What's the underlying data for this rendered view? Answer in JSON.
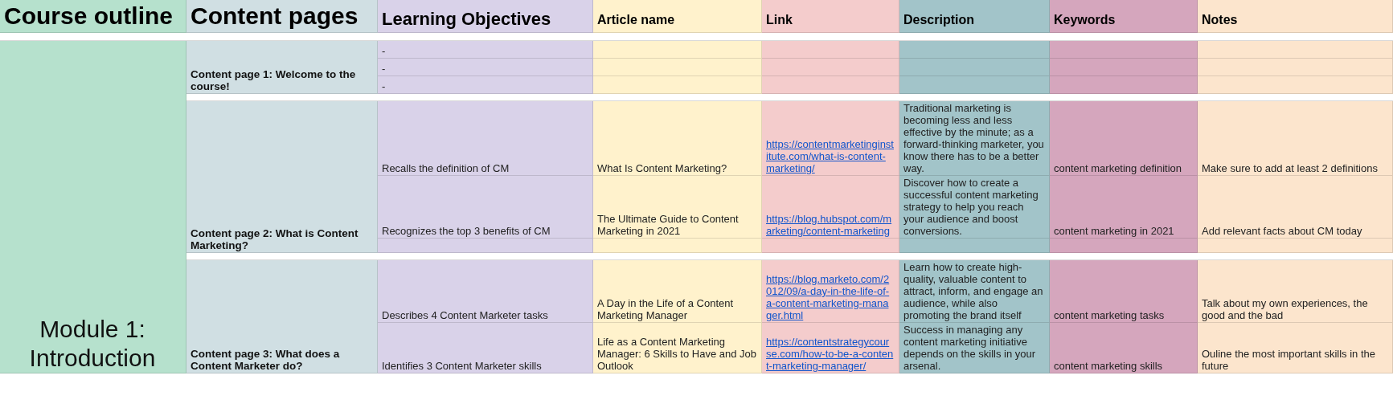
{
  "columns": [
    {
      "label": "Course outline",
      "kind": "large",
      "color": "#b6e1cd"
    },
    {
      "label": "Content pages",
      "kind": "large",
      "color": "#d0dfe3"
    },
    {
      "label": "Learning Objectives",
      "kind": "medium",
      "color": "#d9d2e9"
    },
    {
      "label": "Article name",
      "kind": "small",
      "color": "#fff2cc"
    },
    {
      "label": "Link",
      "kind": "small",
      "color": "#f4cccc"
    },
    {
      "label": "Description",
      "kind": "small",
      "color": "#a2c4c9"
    },
    {
      "label": "Keywords",
      "kind": "small",
      "color": "#d5a6bd"
    },
    {
      "label": "Notes",
      "kind": "small",
      "color": "#fce5cd"
    }
  ],
  "module": "Module 1: Introduction",
  "sections": [
    {
      "page": "Content page 1: Welcome to the course!",
      "rows": [
        {
          "objective": "-"
        },
        {
          "objective": "-"
        },
        {
          "objective": "-"
        }
      ]
    },
    {
      "page": "Content page 2: What is Content Marketing?",
      "rows": [
        {
          "objective": "Recalls the definition of CM",
          "article": "What Is Content Marketing?",
          "link": "https://contentmarketinginstitute.com/what-is-content-marketing/",
          "description": "Traditional marketing is becoming less and less effective by the minute; as a forward-thinking marketer, you know there has to be a better way.",
          "keywords": "content marketing definition",
          "notes": "Make sure to add at least 2 definitions"
        },
        {
          "objective": "Recognizes the top 3 benefits of CM",
          "article": "The Ultimate Guide to Content Marketing in 2021",
          "link": "https://blog.hubspot.com/marketing/content-marketing",
          "description": "Discover how to create a successful content marketing strategy to help you reach your audience and boost conversions.",
          "keywords": "content marketing in 2021",
          "notes": "Add relevant facts about CM today"
        },
        {}
      ]
    },
    {
      "page": "Content page 3: What does a Content Marketer do?",
      "rows": [
        {
          "objective": "Describes 4 Content Marketer tasks",
          "article": "A Day in the Life of a Content Marketing Manager",
          "link": "https://blog.marketo.com/2012/09/a-day-in-the-life-of-a-content-marketing-manager.html",
          "description": "Learn how to create high-quality, valuable content to attract, inform, and engage an audience, while also promoting the brand itself",
          "keywords": "content marketing tasks",
          "notes": "Talk about my own experiences, the good and the bad"
        },
        {
          "objective": "Identifies 3 Content Marketer skills",
          "article": "Life as a Content Marketing Manager: 6 Skills to Have and Job Outlook",
          "link": "https://contentstrategycourse.com/how-to-be-a-content-marketing-manager/",
          "description": "Success in managing any content marketing initiative depends on the skills in your arsenal.",
          "keywords": "content marketing skills",
          "notes": "Ouline the most important skills in the future"
        }
      ]
    }
  ]
}
